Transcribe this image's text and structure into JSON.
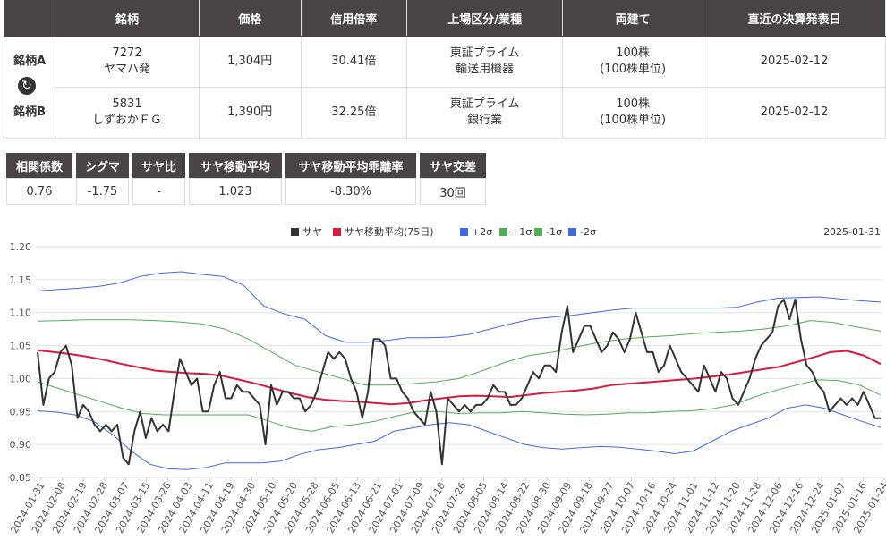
{
  "pair_table": {
    "headers": [
      "銘柄",
      "価格",
      "信用倍率",
      "上場区分/業種",
      "両建て",
      "直近の決算発表日"
    ],
    "rows": [
      {
        "label": "銘柄A",
        "code": "7272",
        "name": "ヤマハ発",
        "price": "1,304円",
        "margin_ratio": "30.41倍",
        "market": "東証プライム",
        "industry": "輸送用機器",
        "hedge": "100株",
        "hedge_unit": "(100株単位)",
        "earnings_date": "2025-02-12"
      },
      {
        "label": "銘柄B",
        "code": "5831",
        "name": "しずおかＦＧ",
        "price": "1,390円",
        "margin_ratio": "32.25倍",
        "market": "東証プライム",
        "industry": "銀行業",
        "hedge": "100株",
        "hedge_unit": "(100株単位)",
        "earnings_date": "2025-02-12"
      }
    ],
    "swap_icon": "swap-icon"
  },
  "stats": {
    "headers": [
      "相関係数",
      "シグマ",
      "サヤ比",
      "サヤ移動平均",
      "サヤ移動平均乖離率",
      "サヤ交差"
    ],
    "values": [
      "0.76",
      "-1.75",
      "-",
      "1.023",
      "-8.30%",
      "30回"
    ]
  },
  "chart_data": {
    "type": "line",
    "date_label": "2025-01-31",
    "ylim": [
      0.85,
      1.2
    ],
    "yticks": [
      "0.85",
      "0.90",
      "0.95",
      "1.00",
      "1.05",
      "1.10",
      "1.15",
      "1.20"
    ],
    "x_start": "2024-01-31",
    "x_end": "2025-01-31",
    "xticks": [
      "2024-01-31",
      "2024-02-08",
      "2024-02-19",
      "2024-02-28",
      "2024-03-07",
      "2024-03-15",
      "2024-03-26",
      "2024-04-03",
      "2024-04-11",
      "2024-04-19",
      "2024-04-30",
      "2024-05-10",
      "2024-05-20",
      "2024-05-28",
      "2024-06-05",
      "2024-06-13",
      "2024-06-21",
      "2024-07-01",
      "2024-07-09",
      "2024-07-18",
      "2024-07-26",
      "2024-08-05",
      "2024-08-14",
      "2024-08-22",
      "2024-08-30",
      "2024-09-09",
      "2024-09-18",
      "2024-09-27",
      "2024-10-07",
      "2024-10-16",
      "2024-10-24",
      "2024-11-01",
      "2024-11-12",
      "2024-11-20",
      "2024-11-28",
      "2024-12-06",
      "2024-12-16",
      "2024-12-24",
      "2025-01-07",
      "2025-01-16",
      "2025-01-24"
    ],
    "colors": {
      "saya": "#333333",
      "ma": "#d81b3c",
      "p2": "#3c6ae8",
      "p1": "#4caf50",
      "m1": "#4caf50",
      "m2": "#3c6ae8"
    },
    "series": [
      {
        "name": "サヤ",
        "color_key": "saya",
        "values": [
          1.04,
          0.96,
          1.0,
          1.01,
          1.04,
          1.05,
          1.02,
          0.94,
          0.96,
          0.95,
          0.93,
          0.92,
          0.93,
          0.92,
          0.93,
          0.88,
          0.87,
          0.92,
          0.95,
          0.91,
          0.94,
          0.92,
          0.93,
          0.92,
          0.98,
          1.03,
          1.01,
          0.99,
          1.0,
          0.95,
          0.95,
          0.99,
          1.01,
          0.97,
          0.97,
          0.99,
          0.98,
          0.98,
          0.97,
          0.96,
          0.9,
          0.99,
          0.96,
          0.98,
          0.98,
          0.97,
          0.97,
          0.95,
          0.96,
          0.98,
          1.01,
          1.04,
          1.03,
          1.04,
          1.03,
          1.0,
          0.98,
          0.94,
          0.98,
          1.06,
          1.06,
          1.05,
          1.0,
          1.0,
          0.98,
          0.97,
          0.95,
          0.94,
          0.93,
          0.98,
          0.95,
          0.87,
          0.97,
          0.96,
          0.95,
          0.96,
          0.95,
          0.96,
          0.96,
          0.97,
          0.99,
          0.98,
          0.98,
          0.96,
          0.96,
          0.97,
          0.99,
          1.01,
          1.0,
          1.02,
          1.02,
          1.01,
          1.07,
          1.11,
          1.04,
          1.06,
          1.08,
          1.08,
          1.06,
          1.04,
          1.05,
          1.07,
          1.06,
          1.04,
          1.06,
          1.1,
          1.07,
          1.04,
          1.04,
          1.01,
          1.02,
          1.05,
          1.03,
          1.01,
          1.0,
          0.99,
          0.98,
          1.02,
          1.0,
          0.98,
          1.01,
          1.0,
          0.97,
          0.96,
          0.98,
          1.0,
          1.03,
          1.05,
          1.06,
          1.07,
          1.11,
          1.12,
          1.09,
          1.12,
          1.06,
          1.02,
          1.01,
          0.99,
          0.98,
          0.95,
          0.96,
          0.97,
          0.96,
          0.97,
          0.96,
          0.98,
          0.96,
          0.94,
          0.94
        ]
      },
      {
        "name": "サヤ移動平均(75日)",
        "color_key": "ma",
        "values": [
          1.043,
          1.04,
          1.037,
          1.033,
          1.028,
          1.022,
          1.017,
          1.012,
          1.01,
          1.008,
          1.007,
          1.004,
          0.998,
          0.992,
          0.985,
          0.978,
          0.972,
          0.968,
          0.966,
          0.965,
          0.963,
          0.961,
          0.963,
          0.967,
          0.97,
          0.973,
          0.974,
          0.973,
          0.972,
          0.975,
          0.978,
          0.98,
          0.982,
          0.985,
          0.99,
          0.992,
          0.994,
          0.996,
          0.998,
          1.0,
          1.003,
          1.006,
          1.01,
          1.014,
          1.018,
          1.025,
          1.032,
          1.04,
          1.042,
          1.035,
          1.022
        ]
      },
      {
        "name": "+2σ",
        "color_key": "p2",
        "values": [
          1.133,
          1.135,
          1.137,
          1.14,
          1.145,
          1.155,
          1.16,
          1.162,
          1.158,
          1.155,
          1.142,
          1.11,
          1.098,
          1.09,
          1.065,
          1.055,
          1.055,
          1.058,
          1.062,
          1.062,
          1.063,
          1.067,
          1.075,
          1.083,
          1.09,
          1.093,
          1.096,
          1.1,
          1.104,
          1.107,
          1.107,
          1.107,
          1.107,
          1.107,
          1.108,
          1.116,
          1.122,
          1.123,
          1.124,
          1.121,
          1.118,
          1.116
        ]
      },
      {
        "name": "+1σ",
        "color_key": "p1",
        "values": [
          1.087,
          1.088,
          1.089,
          1.089,
          1.089,
          1.088,
          1.086,
          1.083,
          1.075,
          1.06,
          1.04,
          1.02,
          1.01,
          1.0,
          0.99,
          0.99,
          0.992,
          0.995,
          1.0,
          1.012,
          1.025,
          1.035,
          1.04,
          1.048,
          1.055,
          1.06,
          1.063,
          1.065,
          1.068,
          1.07,
          1.072,
          1.075,
          1.08,
          1.088,
          1.085,
          1.078,
          1.072
        ]
      },
      {
        "name": "-1σ",
        "color_key": "m1",
        "values": [
          0.995,
          0.985,
          0.975,
          0.965,
          0.955,
          0.947,
          0.945,
          0.945,
          0.945,
          0.945,
          0.945,
          0.935,
          0.925,
          0.92,
          0.927,
          0.93,
          0.935,
          0.943,
          0.95,
          0.95,
          0.947,
          0.948,
          0.948,
          0.95,
          0.948,
          0.946,
          0.945,
          0.946,
          0.948,
          0.948,
          0.95,
          0.951,
          0.954,
          0.96,
          0.972,
          0.982,
          0.99,
          0.998,
          0.997,
          0.99,
          0.975
        ]
      },
      {
        "name": "-2σ",
        "color_key": "m2",
        "values": [
          0.951,
          0.949,
          0.945,
          0.935,
          0.915,
          0.89,
          0.87,
          0.863,
          0.862,
          0.865,
          0.872,
          0.872,
          0.872,
          0.875,
          0.885,
          0.892,
          0.895,
          0.9,
          0.905,
          0.92,
          0.925,
          0.93,
          0.933,
          0.93,
          0.92,
          0.91,
          0.9,
          0.895,
          0.893,
          0.895,
          0.897,
          0.896,
          0.893,
          0.89,
          0.886,
          0.89,
          0.905,
          0.92,
          0.93,
          0.94,
          0.955,
          0.96,
          0.955,
          0.945,
          0.935,
          0.926
        ]
      }
    ]
  }
}
